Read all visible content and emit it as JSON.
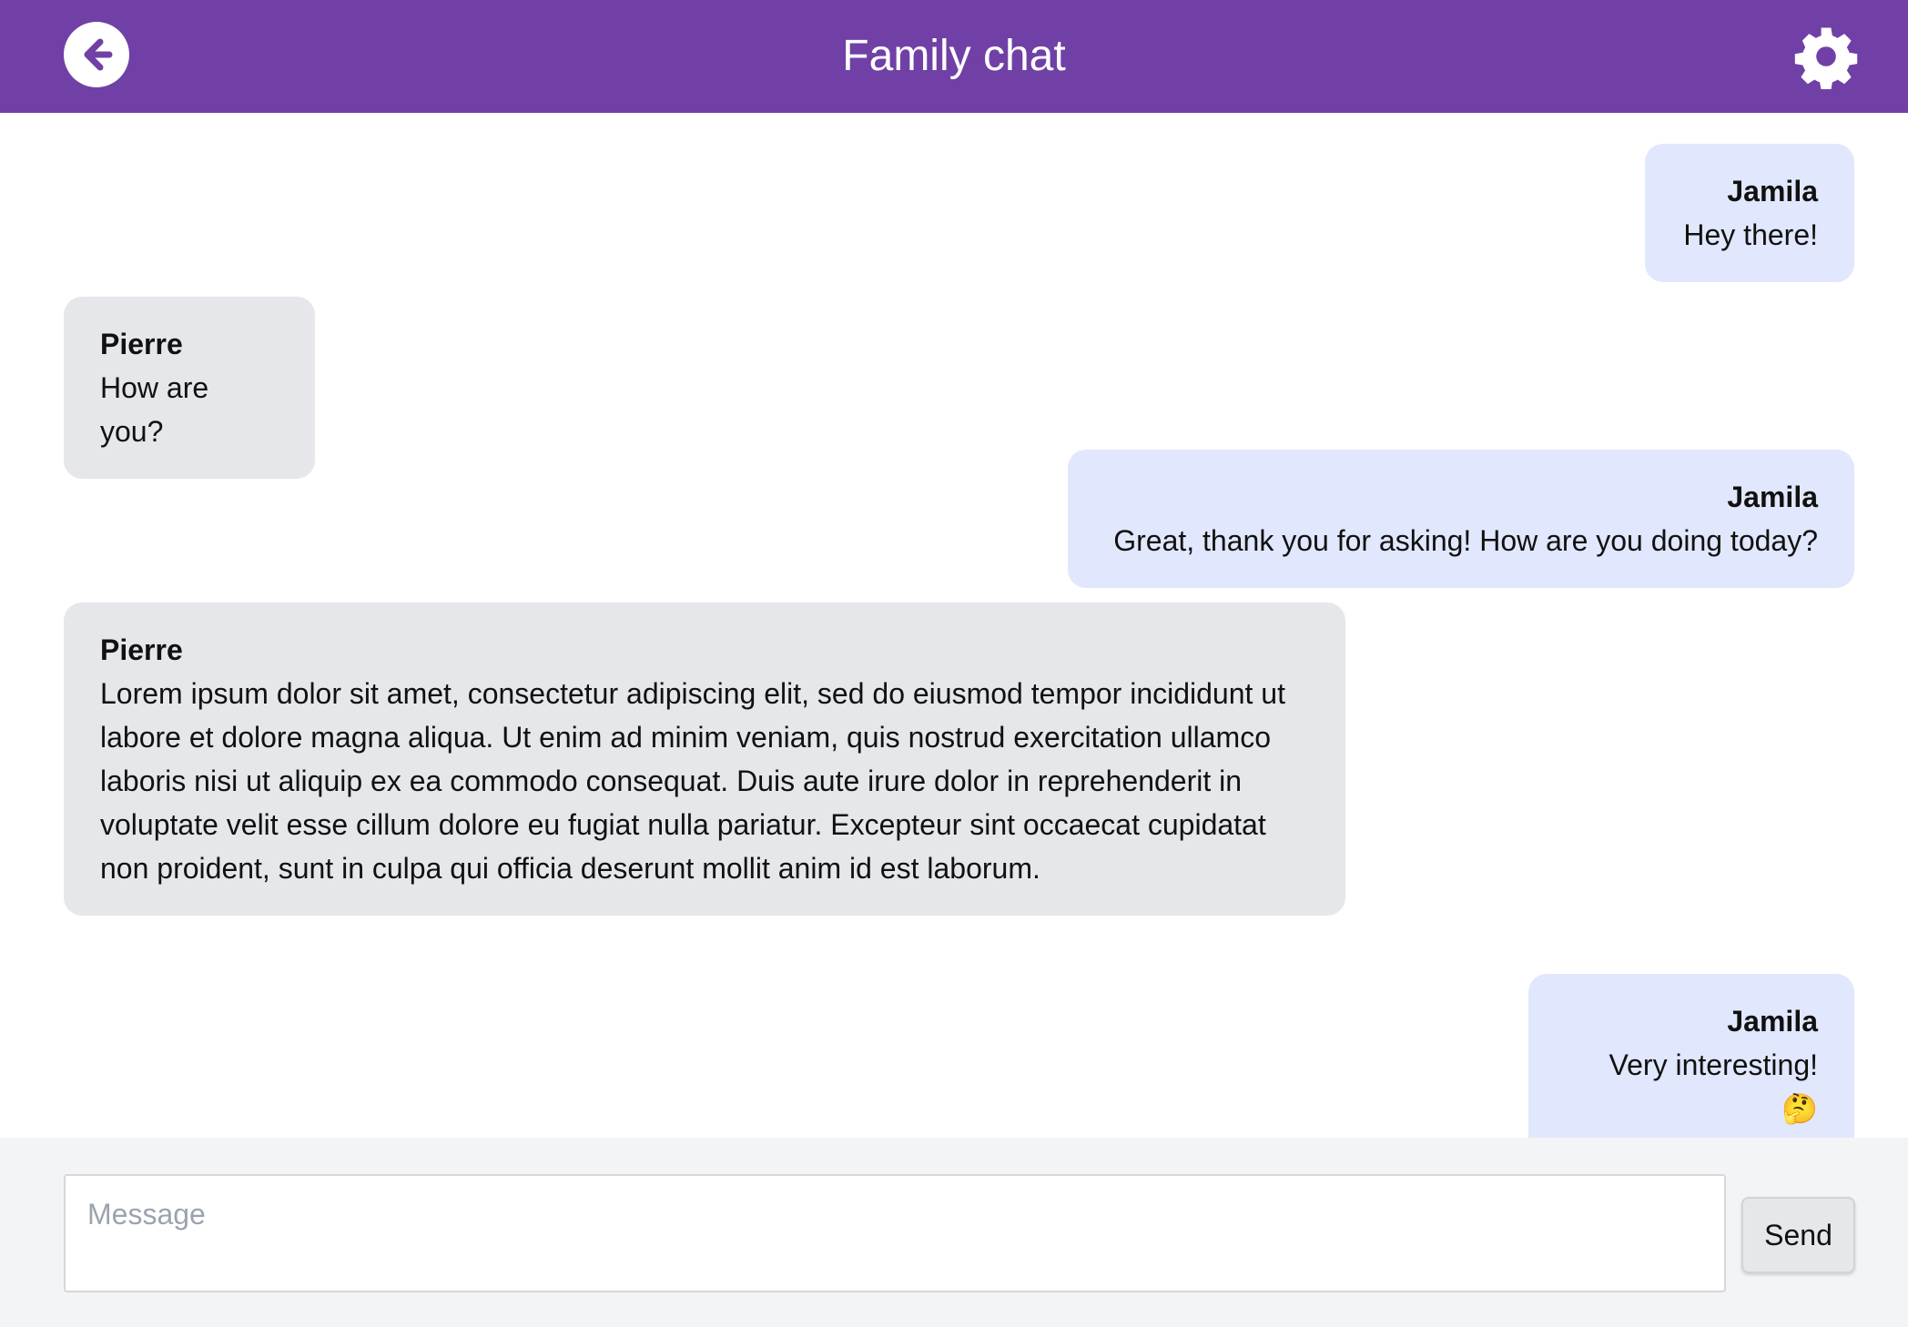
{
  "header": {
    "title": "Family chat",
    "back_icon": "arrow-left-circle-icon",
    "settings_icon": "gear-icon"
  },
  "colors": {
    "header_bg": "#7040a6",
    "my_bubble": "#e1e7fc",
    "their_bubble": "#e5e7eb",
    "composer_bg": "#f3f4f6"
  },
  "messages": [
    {
      "sender": "Jamila",
      "text": "Hey there!",
      "mine": true
    },
    {
      "sender": "Pierre",
      "text": "How are you?",
      "mine": false
    },
    {
      "sender": "Jamila",
      "text": "Great, thank you for asking! How are you doing today?",
      "mine": true
    },
    {
      "sender": "Pierre",
      "text": "Lorem ipsum dolor sit amet, consectetur adipiscing elit, sed do eiusmod tempor incididunt ut labore et dolore magna aliqua. Ut enim ad minim veniam, quis nostrud exercitation ullamco laboris nisi ut aliquip ex ea commodo consequat. Duis aute irure dolor in reprehenderit in voluptate velit esse cillum dolore eu fugiat nulla pariatur. Excepteur sint occaecat cupidatat non proident, sunt in culpa qui officia deserunt mollit anim id est laborum.",
      "mine": false
    },
    {
      "sender": "Jamila",
      "text": "Very interesting! 🤔",
      "mine": true
    }
  ],
  "composer": {
    "placeholder": "Message",
    "value": "",
    "send_label": "Send"
  }
}
